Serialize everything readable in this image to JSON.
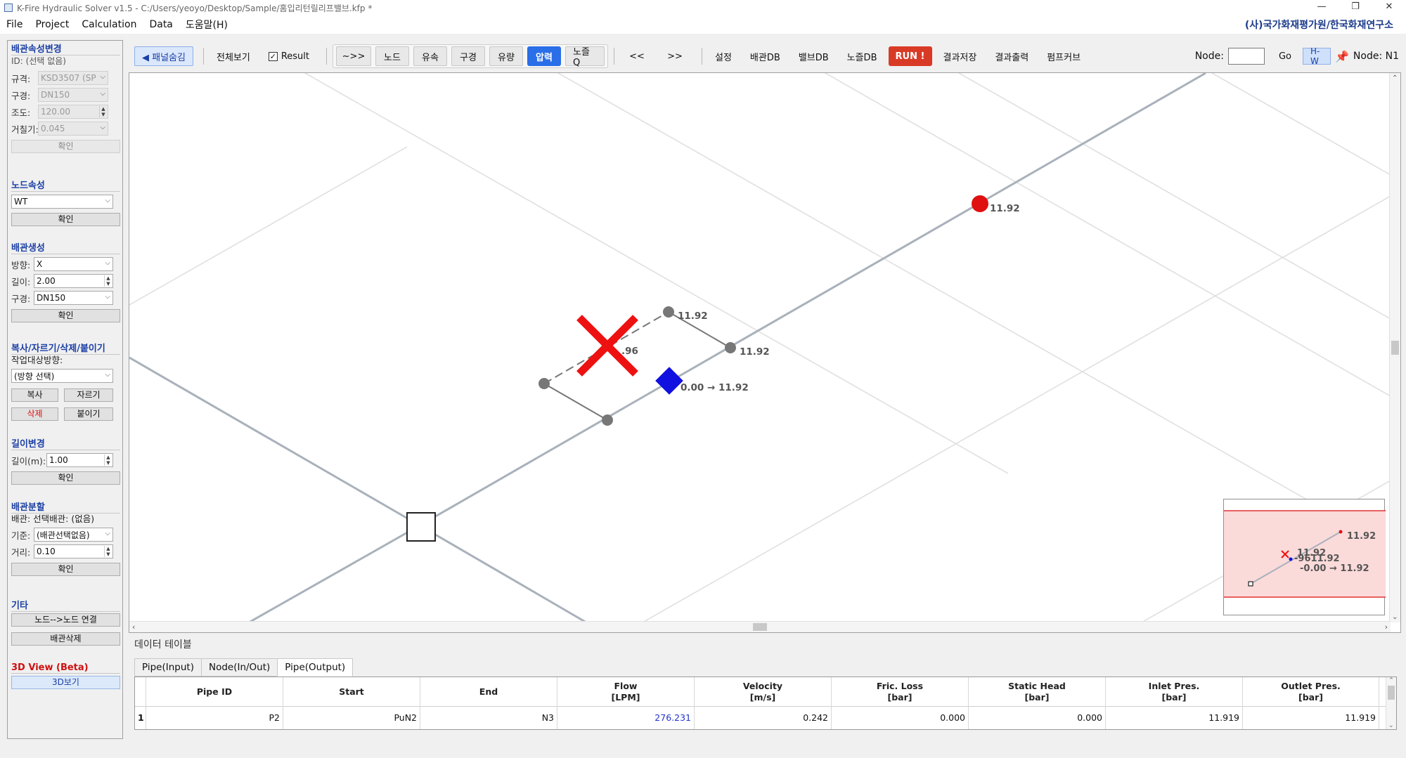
{
  "window": {
    "title": "K-Fire Hydraulic Solver v1.5 - C:/Users/yeoyo/Desktop/Sample/홈입리턴릴리프밸브.kfp *",
    "controls": [
      "—",
      "❐",
      "✕"
    ]
  },
  "menu": {
    "items": [
      "File",
      "Project",
      "Calculation",
      "Data",
      "도움말(H)"
    ],
    "org": "(사)국가화재평가원/한국화재연구소"
  },
  "left_panel": {
    "pipe_attr": {
      "title": "배관속성변경",
      "id_label": "ID: (선택 없음)",
      "spec_label": "규격:",
      "spec_value": "KSD3507 (SP",
      "diameter_label": "구경:",
      "diameter_value": "DN150",
      "c_label": "조도:",
      "c_value": "120.00",
      "roughness_label": "거칠기:",
      "roughness_value": "0.045",
      "confirm": "확인"
    },
    "node_attr": {
      "title": "노드속성",
      "value": "WT",
      "confirm": "확인"
    },
    "pipe_create": {
      "title": "배관생성",
      "dir_label": "방향:",
      "dir_value": "X",
      "len_label": "길이:",
      "len_value": "2.00",
      "dia_label": "구경:",
      "dia_value": "DN150",
      "confirm": "확인"
    },
    "edit": {
      "title": "복사/자르기/삭제/붙이기",
      "target_label": "작업대상방향:",
      "target_value": "(방향 선택)",
      "copy": "복사",
      "cut": "자르기",
      "delete": "삭제",
      "paste": "붙이기"
    },
    "length_change": {
      "title": "길이변경",
      "label": "길이(m):",
      "value": "1.00",
      "confirm": "확인"
    },
    "pipe_split": {
      "title": "배관분할",
      "info": "배관: 선택배관: (없음)",
      "base_label": "기준:",
      "base_value": "(배관선택없음)",
      "dist_label": "거리:",
      "dist_value": "0.10",
      "confirm": "확인"
    },
    "etc": {
      "title": "기타",
      "connect": "노드-->노드 연결",
      "delete_pipe": "배관삭제"
    },
    "view3d": {
      "title": "3D View (Beta)",
      "button": "3D보기"
    }
  },
  "toolbar": {
    "panel_hide": "◀ 패널숨김",
    "full_view": "전체보기",
    "result_label": "Result",
    "result_checked": true,
    "buttons": [
      "~>>",
      "노드",
      "유속",
      "구경",
      "유량",
      "압력",
      "노즐Q"
    ],
    "active": "압력",
    "prev": "<<",
    "next": ">>",
    "settings": "설정",
    "pipe_db": "배관DB",
    "valve_db": "밸브DB",
    "nozzle_db": "노즐DB",
    "run": "RUN !",
    "save_result": "결과저장",
    "print_result": "결과출력",
    "pump_curve": "펌프커브",
    "node_label": "Node:",
    "node_value": "",
    "go": "Go",
    "hw": "H-W",
    "node_current": "Node: N1"
  },
  "canvas": {
    "labels": {
      "red_node": "11.92",
      "top_node": "11.92",
      "right_node": "11.92",
      "x_partial": ".96",
      "valve": "0.00 → 11.92"
    },
    "minimap_labels": {
      "red": "11.92",
      "a": "11.92",
      "b": "-9611.92",
      "valve": "-0.00 → 11.92"
    },
    "colors": {
      "pipe": "#a8b0ba",
      "grid": "#d8d8d8",
      "node": "#777777",
      "red_node": "#e01010",
      "valve": "#1010e0",
      "delete_x": "#ee1111"
    }
  },
  "data_table": {
    "title": "데이터 테이블",
    "tabs": [
      "Pipe(Input)",
      "Node(In/Out)",
      "Pipe(Output)"
    ],
    "active_tab": "Pipe(Output)",
    "columns": [
      {
        "l1": "Pipe ID",
        "l2": ""
      },
      {
        "l1": "Start",
        "l2": ""
      },
      {
        "l1": "End",
        "l2": ""
      },
      {
        "l1": "Flow",
        "l2": "[LPM]"
      },
      {
        "l1": "Velocity",
        "l2": "[m/s]"
      },
      {
        "l1": "Fric. Loss",
        "l2": "[bar]"
      },
      {
        "l1": "Static Head",
        "l2": "[bar]"
      },
      {
        "l1": "Inlet Pres.",
        "l2": "[bar]"
      },
      {
        "l1": "Outlet Pres.",
        "l2": "[bar]"
      }
    ],
    "rows": [
      {
        "idx": "1",
        "pipe_id": "P2",
        "start": "PuN2",
        "end": "N3",
        "flow": "276.231",
        "velocity": "0.242",
        "fric": "0.000",
        "static": "0.000",
        "inlet": "11.919",
        "outlet": "11.919"
      }
    ]
  }
}
